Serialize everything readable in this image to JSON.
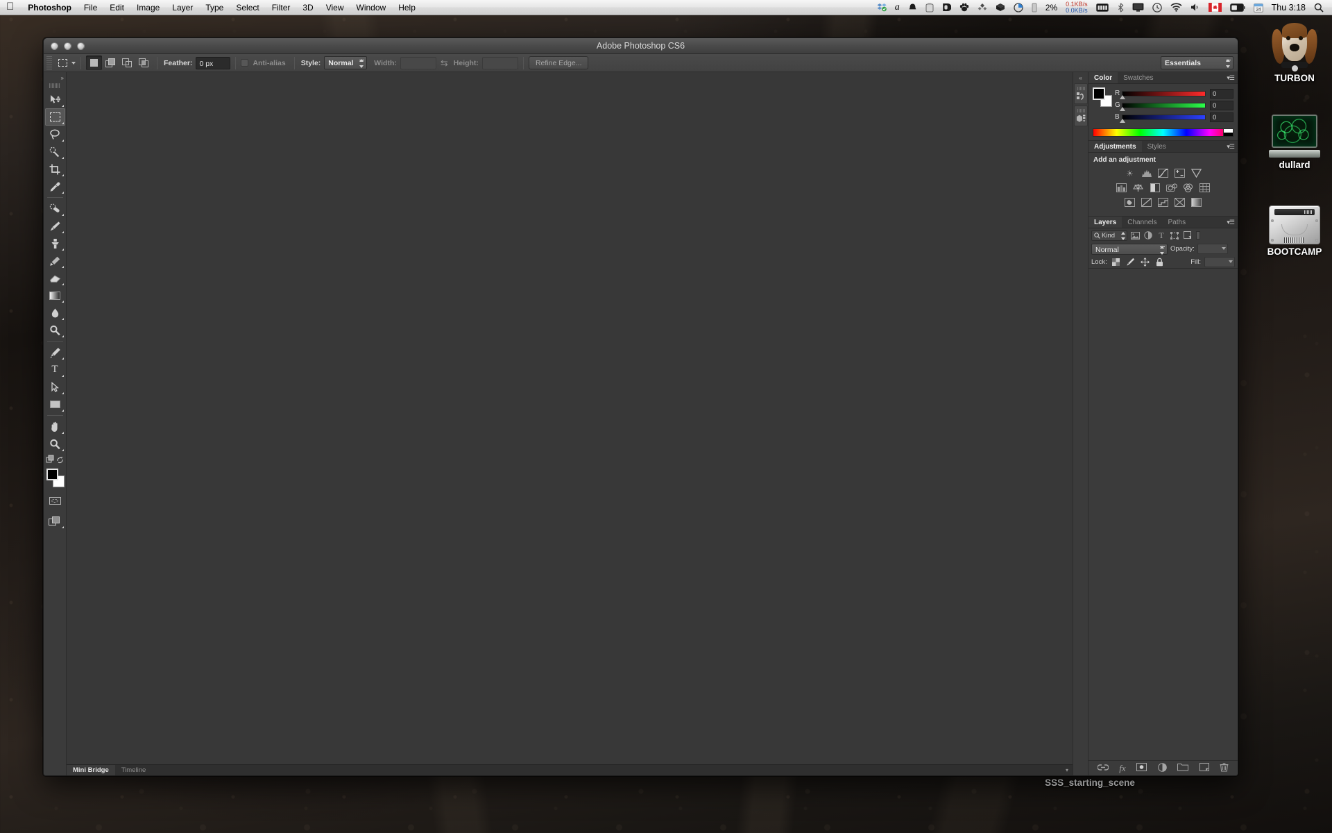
{
  "menubar": {
    "apple_icon": "apple-icon",
    "items": [
      "Photoshop",
      "File",
      "Edit",
      "Image",
      "Layer",
      "Type",
      "Select",
      "Filter",
      "3D",
      "View",
      "Window",
      "Help"
    ],
    "status_icons": [
      "dropbox-icon",
      "alfred-icon",
      "bell-icon",
      "usb-drive-icon",
      "dashlane-icon",
      "paw-icon",
      "diamond-icon",
      "cube-icon",
      "pie-chart-icon",
      "battery-column-icon"
    ],
    "cpu_percent": "2%",
    "network_up": "0.1KB/s",
    "network_down": "0.0KB/s",
    "right_icons": [
      "battery-full-icon",
      "bluetooth-icon",
      "display-icon",
      "time-machine-icon",
      "wifi-icon",
      "volume-icon",
      "flag-canada-icon",
      "battery-icon",
      "calendar-icon"
    ],
    "clock": "Thu 3:18",
    "spotlight_icon": "search-icon"
  },
  "photoshop": {
    "title": "Adobe Photoshop CS6",
    "window_buttons": [
      "close-button",
      "minimize-button",
      "zoom-button"
    ],
    "options_bar": {
      "tool_icon": "rectangular-marquee-icon",
      "selection_modes": [
        "new-selection",
        "add-to-selection",
        "subtract-from-selection",
        "intersect-with-selection"
      ],
      "feather_label": "Feather:",
      "feather_value": "0 px",
      "antialias_label": "Anti-alias",
      "style_label": "Style:",
      "style_value": "Normal",
      "width_label": "Width:",
      "width_value": "",
      "swap_icon": "swap-dimensions-icon",
      "height_label": "Height:",
      "height_value": "",
      "refine_edge_label": "Refine Edge...",
      "workspace_value": "Essentials"
    },
    "tools": [
      {
        "name": "move-tool",
        "glyph": "➤"
      },
      {
        "name": "rectangular-marquee-tool",
        "glyph": "⬚",
        "selected": true
      },
      {
        "name": "lasso-tool",
        "glyph": "○"
      },
      {
        "name": "quick-selection-tool",
        "glyph": "✐"
      },
      {
        "name": "crop-tool",
        "glyph": "⌘"
      },
      {
        "name": "eyedropper-tool",
        "glyph": "✒"
      },
      {
        "name": "spot-healing-brush-tool",
        "glyph": "⊕"
      },
      {
        "name": "brush-tool",
        "glyph": "✎"
      },
      {
        "name": "clone-stamp-tool",
        "glyph": "⬛"
      },
      {
        "name": "history-brush-tool",
        "glyph": "✇"
      },
      {
        "name": "eraser-tool",
        "glyph": "▰"
      },
      {
        "name": "gradient-tool",
        "glyph": "▤"
      },
      {
        "name": "blur-tool",
        "glyph": "●"
      },
      {
        "name": "dodge-tool",
        "glyph": "⚲"
      },
      {
        "name": "pen-tool",
        "glyph": "✑"
      },
      {
        "name": "horizontal-type-tool",
        "glyph": "T"
      },
      {
        "name": "path-selection-tool",
        "glyph": "➤"
      },
      {
        "name": "rectangle-tool",
        "glyph": "▭"
      },
      {
        "name": "hand-tool",
        "glyph": "✋"
      },
      {
        "name": "zoom-tool",
        "glyph": "⚲"
      }
    ],
    "quick-mask": "edit-in-quick-mask-icon",
    "screen-mode": "change-screen-mode-icon",
    "foreground_color": "#000000",
    "background_color": "#ffffff",
    "bottom_tabs": [
      {
        "label": "Mini Bridge",
        "active": true
      },
      {
        "label": "Timeline",
        "active": false
      }
    ],
    "dock_rail": [
      "history-panel-icon",
      "properties-panel-icon"
    ],
    "panels": {
      "color": {
        "tabs": [
          {
            "label": "Color",
            "active": true
          },
          {
            "label": "Swatches",
            "active": false
          }
        ],
        "channels": [
          {
            "label": "R",
            "value": "0"
          },
          {
            "label": "G",
            "value": "0"
          },
          {
            "label": "B",
            "value": "0"
          }
        ]
      },
      "adjustments": {
        "tabs": [
          {
            "label": "Adjustments",
            "active": true
          },
          {
            "label": "Styles",
            "active": false
          }
        ],
        "heading": "Add an adjustment",
        "icons_row1": [
          "brightness-contrast-icon",
          "levels-icon",
          "curves-icon",
          "exposure-icon",
          "vibrance-icon"
        ],
        "icons_row2": [
          "hue-saturation-icon",
          "color-balance-icon",
          "black-white-icon",
          "photo-filter-icon",
          "channel-mixer-icon",
          "color-lookup-icon"
        ],
        "icons_row3": [
          "invert-icon",
          "posterize-icon",
          "threshold-icon",
          "selective-color-icon",
          "gradient-map-icon"
        ]
      },
      "layers": {
        "tabs": [
          {
            "label": "Layers",
            "active": true
          },
          {
            "label": "Channels",
            "active": false
          },
          {
            "label": "Paths",
            "active": false
          }
        ],
        "filter_label": "Kind",
        "filter_icons": [
          "filter-pixel-icon",
          "filter-adjustment-icon",
          "filter-type-icon",
          "filter-shape-icon",
          "filter-smart-object-icon"
        ],
        "blend_mode": "Normal",
        "opacity_label": "Opacity:",
        "opacity_value": "",
        "lock_label": "Lock:",
        "lock_icons": [
          "lock-transparent-pixels-icon",
          "lock-image-pixels-icon",
          "lock-position-icon",
          "lock-all-icon"
        ],
        "fill_label": "Fill:",
        "fill_value": "",
        "footer_icons": [
          "link-layers-icon",
          "layer-style-fx-icon",
          "add-layer-mask-icon",
          "new-adjustment-layer-icon",
          "new-group-icon",
          "new-layer-icon",
          "delete-layer-icon"
        ]
      }
    }
  },
  "desktop": {
    "icons": [
      {
        "label": "TURBON",
        "icon": "dog-volume-icon"
      },
      {
        "label": "dullard",
        "icon": "network-display-icon"
      },
      {
        "label": "BOOTCAMP",
        "icon": "hard-disk-icon"
      }
    ],
    "file_label": "SSS_starting_scene"
  }
}
